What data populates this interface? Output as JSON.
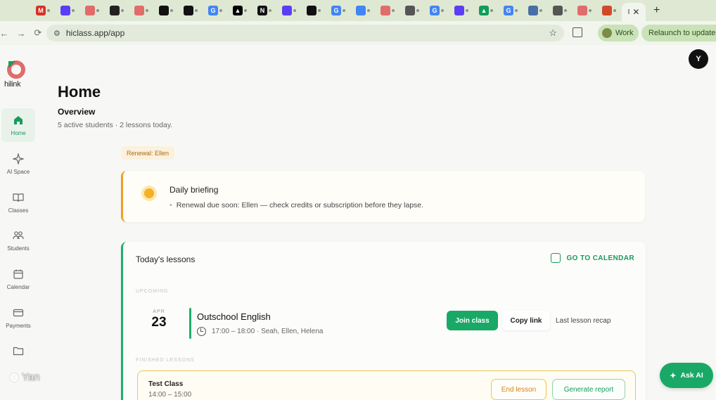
{
  "browser": {
    "tabs": [
      {
        "icon": "gmail-icon",
        "color": "#d93025",
        "glyph": "M"
      },
      {
        "icon": "app-icon",
        "color": "#5b3df5",
        "glyph": ""
      },
      {
        "icon": "hiclass-icon",
        "color": "#e06c6c",
        "glyph": ""
      },
      {
        "icon": "openai-icon",
        "color": "#222222",
        "glyph": ""
      },
      {
        "icon": "hiclass-icon",
        "color": "#e06c6c",
        "glyph": ""
      },
      {
        "icon": "github-icon",
        "color": "#111111",
        "glyph": ""
      },
      {
        "icon": "github-icon",
        "color": "#111111",
        "glyph": ""
      },
      {
        "icon": "google-icon",
        "color": "#4285f4",
        "glyph": "G"
      },
      {
        "icon": "vercel-icon",
        "color": "#000000",
        "glyph": "▲"
      },
      {
        "icon": "notion-icon",
        "color": "#111111",
        "glyph": "N"
      },
      {
        "icon": "app-icon",
        "color": "#5b3df5",
        "glyph": ""
      },
      {
        "icon": "github-icon",
        "color": "#111111",
        "glyph": ""
      },
      {
        "icon": "google-icon",
        "color": "#4285f4",
        "glyph": "G"
      },
      {
        "icon": "docs-icon",
        "color": "#4285f4",
        "glyph": ""
      },
      {
        "icon": "hiclass-icon",
        "color": "#e06c6c",
        "glyph": ""
      },
      {
        "icon": "globe-icon",
        "color": "#555555",
        "glyph": ""
      },
      {
        "icon": "google-icon",
        "color": "#4285f4",
        "glyph": "G"
      },
      {
        "icon": "chat-icon",
        "color": "#5b3df5",
        "glyph": ""
      },
      {
        "icon": "drive-icon",
        "color": "#0f9d58",
        "glyph": "▲"
      },
      {
        "icon": "google-icon",
        "color": "#4285f4",
        "glyph": "G"
      },
      {
        "icon": "site-icon",
        "color": "#4a6fa5",
        "glyph": ""
      },
      {
        "icon": "globe-icon",
        "color": "#555555",
        "glyph": ""
      },
      {
        "icon": "app-icon",
        "color": "#e06c6c",
        "glyph": ""
      },
      {
        "icon": "site-icon",
        "color": "#d04a2a",
        "glyph": ""
      }
    ],
    "active_tab_label": "I",
    "url": "hiclass.app/app",
    "profile_label": "Work",
    "relaunch_label": "Relaunch to update"
  },
  "sidebar": {
    "logo_text": "hilink",
    "items": [
      {
        "label": "Home",
        "icon": "home-icon",
        "active": true
      },
      {
        "label": "AI Space",
        "icon": "sparkle-icon",
        "active": false
      },
      {
        "label": "Classes",
        "icon": "book-icon",
        "active": false
      },
      {
        "label": "Students",
        "icon": "students-icon",
        "active": false
      },
      {
        "label": "Calendar",
        "icon": "calendar-icon",
        "active": false
      },
      {
        "label": "Payments",
        "icon": "card-icon",
        "active": false
      },
      {
        "label": "",
        "icon": "folder-icon",
        "active": false
      }
    ]
  },
  "user": {
    "avatar_initial": "Y"
  },
  "page": {
    "title": "Home",
    "subtitle": "Overview",
    "summary": "5 active students · 2 lessons today.",
    "renewal_badge": "Renewal: Ellen"
  },
  "briefing": {
    "title": "Daily briefing",
    "items": [
      "Renewal due soon: Ellen — check credits or subscription before they lapse."
    ]
  },
  "lessons": {
    "title": "Today's lessons",
    "calendar_link": "GO TO CALENDAR",
    "upcoming_label": "UPCOMING",
    "finished_label": "FINISHED LESSONS",
    "upcoming": {
      "month": "APR",
      "day": "23",
      "name": "Outschool English",
      "time": "17:00 – 18:00",
      "students": "Seah, Ellen, Helena",
      "join_label": "Join class",
      "copy_label": "Copy link",
      "recap_label": "Last lesson recap"
    },
    "finished": {
      "name": "Test Class",
      "time": "14:00 – 15:00",
      "end_label": "End lesson",
      "report_label": "Generate report"
    }
  },
  "ask_ai_label": "Ask AI",
  "watermark_text": "Yan",
  "colors": {
    "brand_green": "#1aa866",
    "accent_amber": "#f0a020",
    "logo_coral": "#e06c6c",
    "chrome_green": "#dfe8d3"
  }
}
